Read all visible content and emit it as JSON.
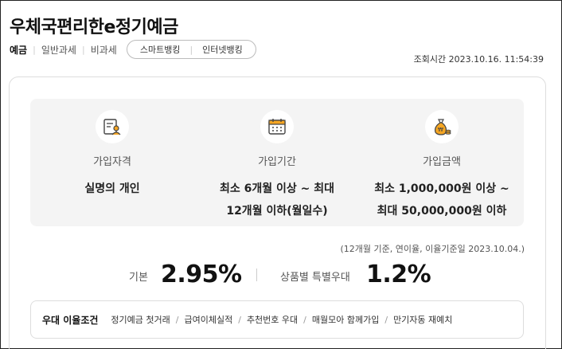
{
  "product": {
    "title": "우체국편리한e정기예금"
  },
  "tags": [
    "예금",
    "일반과세",
    "비과세"
  ],
  "channels": [
    "스마트뱅킹",
    "인터넷뱅킹"
  ],
  "inquiry_time": "조회시간 2023.10.16. 11:54:39",
  "summary": {
    "eligibility": {
      "icon": "person-document-icon",
      "label": "가입자격",
      "value": "실명의 개인"
    },
    "period": {
      "icon": "calendar-icon",
      "label": "가입기간",
      "value_line1": "최소 6개월 이상 ~ 최대",
      "value_line2": "12개월 이하(월일수)"
    },
    "amount": {
      "icon": "money-bag-icon",
      "label": "가입금액",
      "value_line1": "최소 1,000,000원 이상 ~",
      "value_line2": "최대 50,000,000원 이하"
    }
  },
  "rates": {
    "note": "(12개월 기준, 연이율, 이율기준일 2023.10.04.)",
    "base_label": "기본",
    "base_value": "2.95%",
    "special_label": "상품별 특별우대",
    "special_value": "1.2%"
  },
  "conditions": {
    "title": "우대 이율조건",
    "items": [
      "정기예금 첫거래",
      "급여이체실적",
      "추천번호 우대",
      "매월모아 함께가입",
      "만기자동 재예치"
    ]
  },
  "colors": {
    "accent": "#f5a623",
    "panel_bg": "#f4f4f4",
    "text": "#222222"
  }
}
